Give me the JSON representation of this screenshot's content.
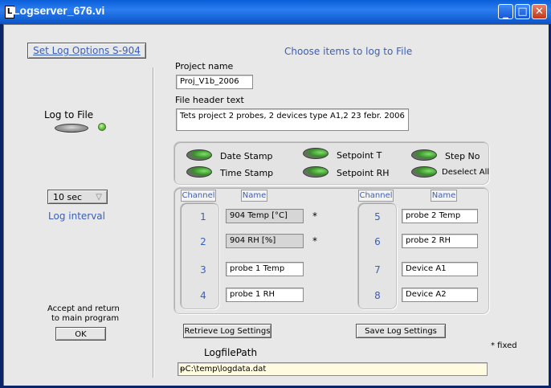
{
  "window": {
    "title": "Logserver_676.vi",
    "app_icon_glyph": "L",
    "min_glyph": "_",
    "max_glyph": "□",
    "close_glyph": "✕"
  },
  "left": {
    "set_log_options": "Set Log Options S-904",
    "log_to_file_label": "Log to File",
    "log_to_file_on": true,
    "interval_value": "10 sec",
    "interval_label": "Log interval",
    "accept_text_1": "Accept and return",
    "accept_text_2": "to main program",
    "ok_label": "OK"
  },
  "main": {
    "heading": "Choose items to log to File",
    "project_name_label": "Project name",
    "project_name_value": "Proj_V1b_2006",
    "header_text_label": "File header text",
    "header_text_value": "Tets project 2 probes, 2 devices type A1,2 23 febr. 2006"
  },
  "options": [
    {
      "label": "Date Stamp",
      "on": true
    },
    {
      "label": "Time Stamp",
      "on": true
    },
    {
      "label": "Setpoint T",
      "on": true
    },
    {
      "label": "Setpoint RH",
      "on": true
    },
    {
      "label": "Step No",
      "on": true
    },
    {
      "label": "Deselect All",
      "on": true
    }
  ],
  "channels": {
    "channel_header": "Channel",
    "name_header": "Name",
    "left": [
      {
        "num": "1",
        "name": "904 Temp [°C]",
        "fixed": "*"
      },
      {
        "num": "2",
        "name": "904 RH [%]",
        "fixed": "*"
      },
      {
        "num": "3",
        "name": "probe 1 Temp",
        "fixed": ""
      },
      {
        "num": "4",
        "name": "probe 1 RH",
        "fixed": ""
      }
    ],
    "right": [
      {
        "num": "5",
        "name": "probe 2 Temp"
      },
      {
        "num": "6",
        "name": "probe 2 RH"
      },
      {
        "num": "7",
        "name": "Device A1"
      },
      {
        "num": "8",
        "name": "Device A2"
      }
    ]
  },
  "bottom": {
    "retrieve_label": "Retrieve Log Settings",
    "save_label": "Save Log Settings",
    "fixed_note": "* fixed",
    "path_label": "LogfilePath",
    "path_value": "C:\\temp\\logdata.dat",
    "path_icon_glyph": "ᵽ"
  },
  "colors": {
    "accent_blue": "#3a5fb8",
    "led_green": "#6cc244",
    "title_bar": "#0a5ed8",
    "path_field_bg": "#fffbe0"
  }
}
